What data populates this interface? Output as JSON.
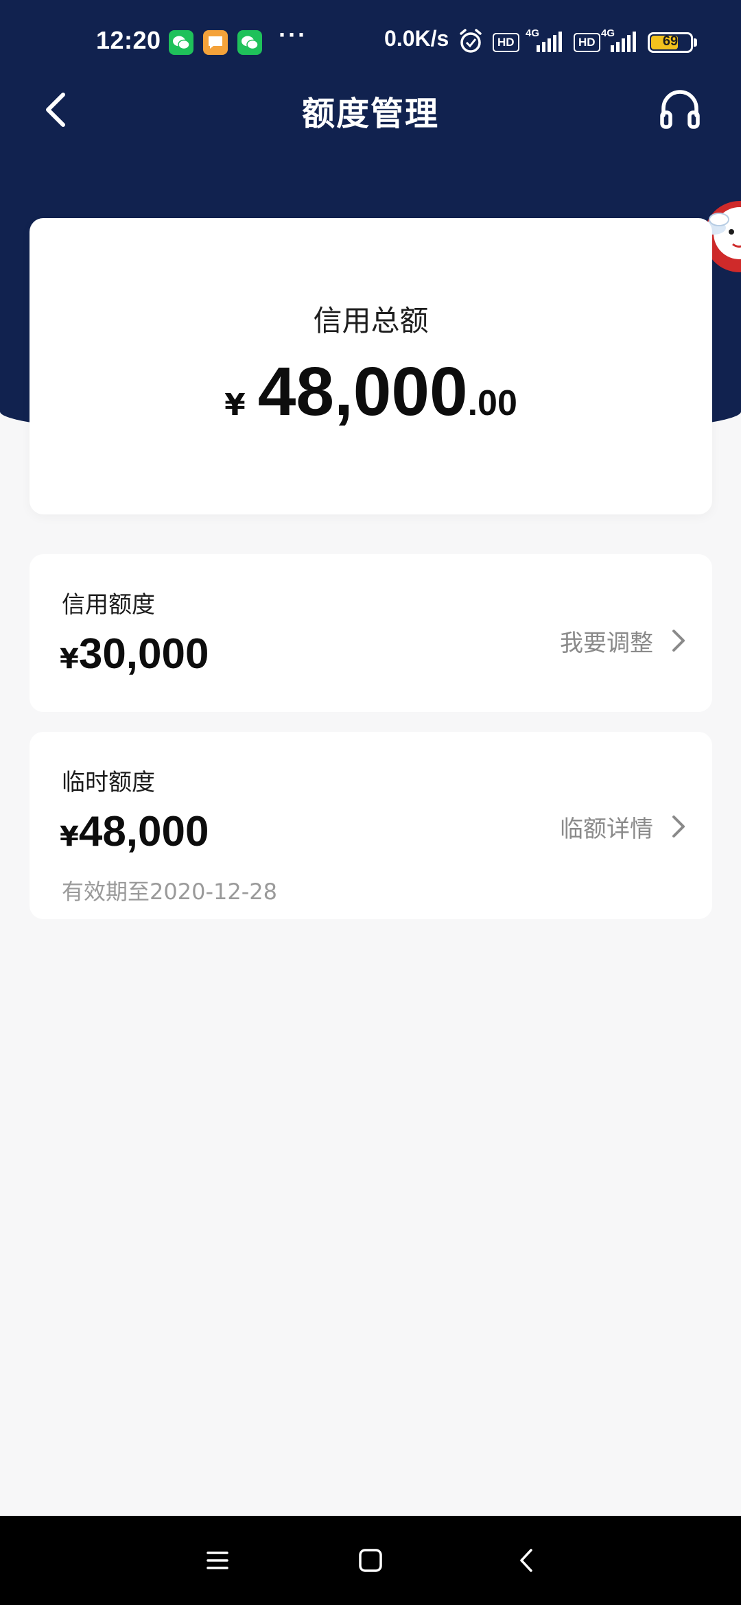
{
  "status_bar": {
    "time": "12:20",
    "more": "···",
    "net_speed": "0.0K/s",
    "sim1_badge": "HD",
    "sim1_network": "4G",
    "sim2_badge": "HD",
    "sim2_network": "4G",
    "battery_level": "69",
    "battery_fraction": 0.69,
    "battery_color": "#f2c11d",
    "notification_icons": [
      "wechat-icon",
      "message-icon",
      "wechat-icon"
    ]
  },
  "header": {
    "title": "额度管理",
    "back_icon": "chevron-left-icon",
    "service_icon": "headphones-icon",
    "background_color": "#11224f"
  },
  "total_card": {
    "label": "信用总额",
    "currency": "¥",
    "amount_integer": "48,000",
    "amount_decimal": ".00"
  },
  "quota_items": [
    {
      "label": "信用额度",
      "currency": "¥",
      "amount": "30,000",
      "action_label": "我要调整"
    },
    {
      "label": "临时额度",
      "currency": "¥",
      "amount": "48,000",
      "action_label": "临额详情",
      "expiry": "有效期至2020-12-28"
    }
  ],
  "system_nav": {
    "buttons": [
      "menu-icon",
      "home-icon",
      "back-icon"
    ]
  }
}
